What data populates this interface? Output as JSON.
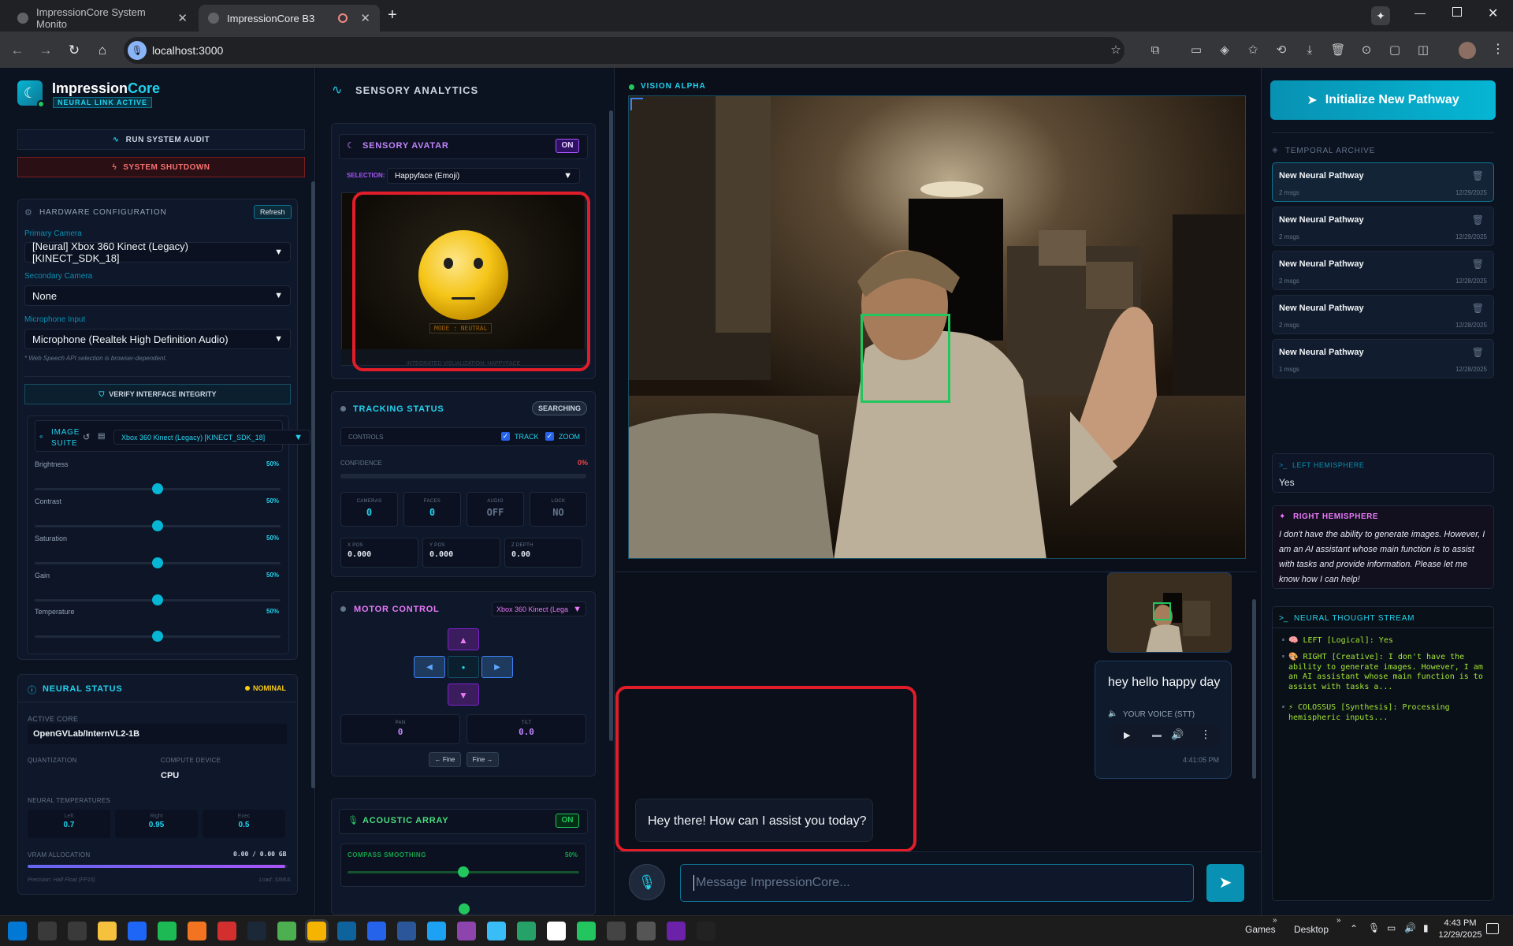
{
  "browser": {
    "tabs": [
      {
        "title": "ImpressionCore System Monito"
      },
      {
        "title": "ImpressionCore B3"
      }
    ],
    "url": "localhost:3000"
  },
  "sidebar": {
    "brand_a": "Impression",
    "brand_b": "Core",
    "brand_badge": "NEURAL LINK ACTIVE",
    "audit_btn": "RUN SYSTEM AUDIT",
    "shutdown_btn": "SYSTEM SHUTDOWN",
    "hw": {
      "title": "HARDWARE CONFIGURATION",
      "refresh": "Refresh",
      "primary_label": "Primary Camera",
      "primary_value": "[Neural] Xbox 360 Kinect (Legacy) [KINECT_SDK_18]",
      "secondary_label": "Secondary Camera",
      "secondary_value": "None",
      "mic_label": "Microphone Input",
      "mic_value": "Microphone (Realtek High Definition Audio)",
      "note": "* Web Speech API selection is browser-dependent.",
      "verify": "VERIFY INTERFACE INTEGRITY"
    },
    "image_suite": {
      "title_1": "IMAGE",
      "title_2": "SUITE",
      "source": "Xbox 360 Kinect (Legacy) [KINECT_SDK_18]",
      "sliders": [
        {
          "label": "Brightness",
          "value": "50%",
          "level": 0.5
        },
        {
          "label": "Contrast",
          "value": "50%",
          "level": 0.5
        },
        {
          "label": "Saturation",
          "value": "50%",
          "level": 0.5
        },
        {
          "label": "Gain",
          "value": "50%",
          "level": 0.5
        },
        {
          "label": "Temperature",
          "value": "50%",
          "level": 0.5
        }
      ]
    },
    "neural": {
      "title": "NEURAL STATUS",
      "status": "NOMINAL",
      "core_label": "ACTIVE CORE",
      "core_value": "OpenGVLab/InternVL2-1B",
      "quant_label": "QUANTIZATION",
      "device_label": "COMPUTE DEVICE",
      "device_value": "CPU",
      "temps_label": "NEURAL TEMPERATURES",
      "temps": [
        {
          "label": "Left",
          "value": "0.7"
        },
        {
          "label": "Right",
          "value": "0.95"
        },
        {
          "label": "Exec",
          "value": "0.5"
        }
      ],
      "vram_label": "VRAM ALLOCATION",
      "vram_value": "0.00 / 0.00 GB",
      "vram_level": 0.99,
      "precision": "Precision: Half Float (FP16)",
      "load": "Load: SIMUL"
    }
  },
  "analytics": {
    "title": "SENSORY ANALYTICS",
    "avatar": {
      "title": "SENSORY AVATAR",
      "toggle": "ON",
      "sel_label": "SELECTION:",
      "sel_value": "Happyface (Emoji)",
      "mode": "MODE : NEUTRAL",
      "footer": "INTEGRATED VISUALIZATION: HAPPYFACE"
    },
    "tracking": {
      "title": "TRACKING STATUS",
      "status": "SEARCHING",
      "controls": "CONTROLS",
      "track": "TRACK",
      "zoom": "ZOOM",
      "confidence": "CONFIDENCE",
      "conf_value": "0%",
      "stats": [
        {
          "label": "CAMERAS",
          "value": "0"
        },
        {
          "label": "FACES",
          "value": "0"
        },
        {
          "label": "AUDIO",
          "value": "OFF"
        },
        {
          "label": "LOCK",
          "value": "NO"
        }
      ],
      "pos": [
        {
          "label": "X POS",
          "value": "0.000"
        },
        {
          "label": "Y POS",
          "value": "0.000"
        },
        {
          "label": "Z DEPTH",
          "value": "0.00"
        }
      ]
    },
    "motor": {
      "title": "MOTOR CONTROL",
      "device": "Xbox 360 Kinect (Lega",
      "pan_label": "PAN",
      "pan_value": "0",
      "tilt_label": "TILT",
      "tilt_value": "0.0",
      "fine_left": "← Fine",
      "fine_right": "Fine →"
    },
    "acoustic": {
      "title": "ACOUSTIC ARRAY",
      "toggle": "ON",
      "smoothing": "COMPASS SMOOTHING",
      "smoothing_value": "50%",
      "smoothing_level": 0.5
    }
  },
  "main": {
    "vision_label": "VISION ALPHA",
    "user_msg": "hey hello happy day",
    "voice_label": "YOUR VOICE (STT)",
    "user_time": "4:41:05 PM",
    "assistant_msg": "Hey there! How can I assist you today?",
    "input_placeholder": "Message ImpressionCore..."
  },
  "right": {
    "init_btn": "Initialize New Pathway",
    "archive_title": "TEMPORAL ARCHIVE",
    "archive": [
      {
        "title": "New Neural Pathway",
        "msgs": "2 msgs",
        "date": "12/29/2025"
      },
      {
        "title": "New Neural Pathway",
        "msgs": "2 msgs",
        "date": "12/29/2025"
      },
      {
        "title": "New Neural Pathway",
        "msgs": "2 msgs",
        "date": "12/28/2025"
      },
      {
        "title": "New Neural Pathway",
        "msgs": "2 msgs",
        "date": "12/28/2025"
      },
      {
        "title": "New Neural Pathway",
        "msgs": "1 msgs",
        "date": "12/28/2025"
      }
    ],
    "left_hemi_title": "LEFT HEMISPHERE",
    "left_hemi_text": "Yes",
    "right_hemi_title": "RIGHT HEMISPHERE",
    "right_hemi_text": "I don't have the ability to generate images. However, I am an AI assistant whose main function is to assist with tasks and provide information. Please let me know how I can help!",
    "thought_title": "NEURAL THOUGHT STREAM",
    "thoughts": [
      "🧠 LEFT [Logical]: Yes",
      "🎨 RIGHT [Creative]: I don't have the ability to generate images. However, I am an AI assistant whose main function is to assist with tasks a...",
      "⚡ COLOSSUS [Synthesis]: Processing hemispheric inputs..."
    ]
  },
  "taskbar": {
    "games": "Games",
    "desktop": "Desktop",
    "time": "4:43 PM",
    "date": "12/29/2025"
  },
  "colors": {
    "accent": "#06b6d4",
    "bg": "#0a0f1a",
    "panel": "#0f172a",
    "highlight": "#e11d2a",
    "green": "#22c55e",
    "purple": "#c084fc"
  }
}
